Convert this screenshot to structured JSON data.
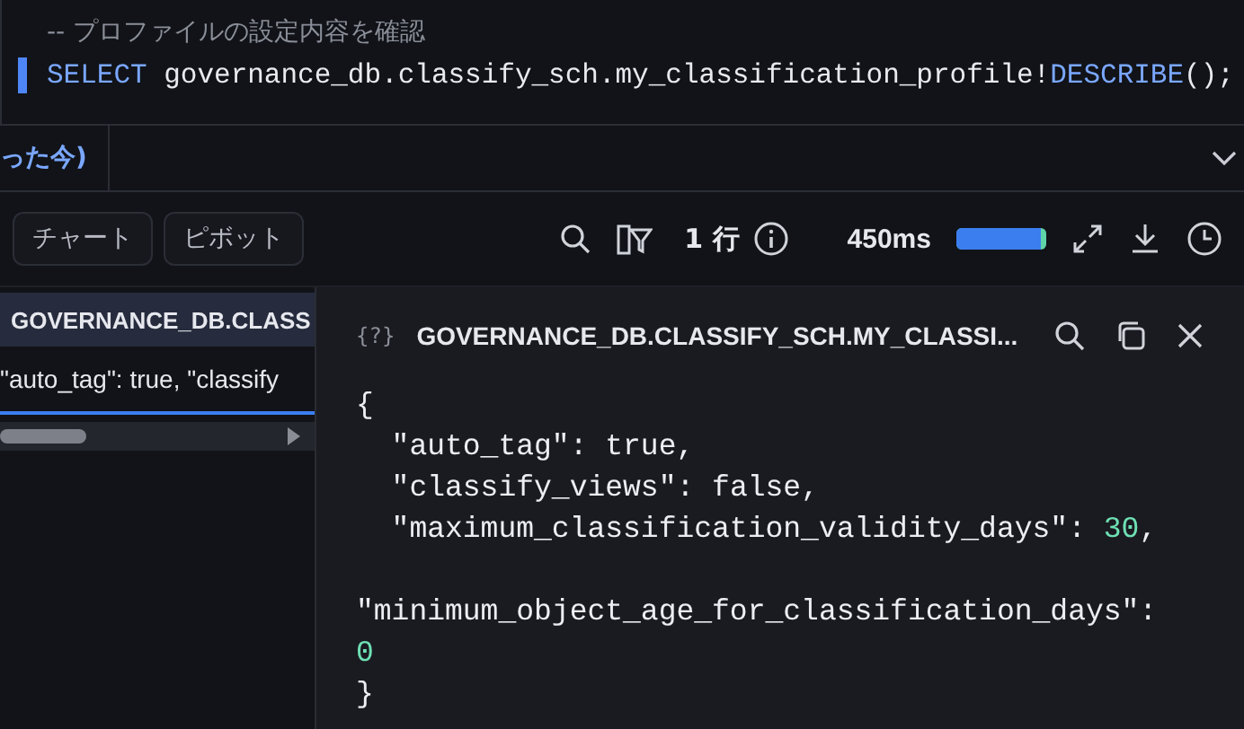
{
  "editor": {
    "comment": "-- プロファイルの設定内容を確認",
    "statement": [
      {
        "text": "SELECT",
        "kind": "keyword"
      },
      {
        "text": " governance_db.classify_sch.my_classification_profile!",
        "kind": "ident"
      },
      {
        "text": "DESCRIBE",
        "kind": "keyword"
      },
      {
        "text": "();",
        "kind": "ident"
      }
    ]
  },
  "result_tab": {
    "label": "った今)"
  },
  "toolbar": {
    "buttons": [
      "チャート",
      "ピボット"
    ],
    "row_count": "1 行",
    "duration": "450ms",
    "progress": {
      "level": 0.94
    }
  },
  "grid": {
    "column_header": "GOVERNANCE_DB.CLASS",
    "cell": "\"auto_tag\": true,  \"classify"
  },
  "detail": {
    "type_icon": "{?}",
    "title": "GOVERNANCE_DB.CLASSIFY_SCH.MY_CLASSI...",
    "blocks": [
      {
        "lines": [
          {
            "tokens": [
              {
                "text": "{",
                "kind": "punct"
              }
            ]
          },
          {
            "tokens": [
              {
                "text": "  \"auto_tag\": ",
                "kind": "key"
              },
              {
                "text": "true",
                "kind": "bool"
              },
              {
                "text": ",",
                "kind": "punct"
              }
            ]
          },
          {
            "tokens": [
              {
                "text": "  \"classify_views\": ",
                "kind": "key"
              },
              {
                "text": "false",
                "kind": "bool"
              },
              {
                "text": ",",
                "kind": "punct"
              }
            ]
          },
          {
            "tokens": [
              {
                "text": "  \"maximum_classification_validity_days\": ",
                "kind": "key"
              },
              {
                "text": "30",
                "kind": "number"
              },
              {
                "text": ",",
                "kind": "punct"
              }
            ]
          }
        ]
      },
      {
        "lines": [
          {
            "tokens": [
              {
                "text": "\"minimum_object_age_for_classification_days\":",
                "kind": "key"
              }
            ]
          },
          {
            "tokens": [
              {
                "text": "0",
                "kind": "number"
              }
            ]
          },
          {
            "tokens": [
              {
                "text": "}",
                "kind": "punct"
              }
            ]
          }
        ]
      }
    ]
  }
}
